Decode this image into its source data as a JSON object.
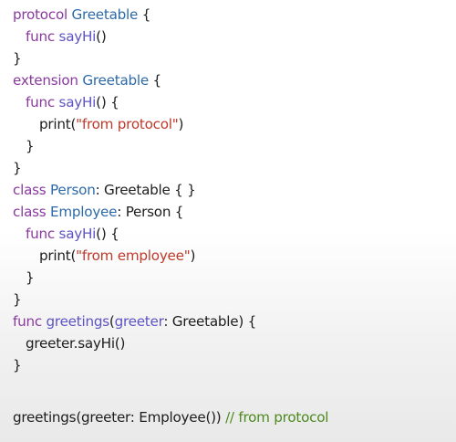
{
  "code_lines": [
    {
      "indent": 0,
      "tokens": [
        {
          "text": "protocol",
          "kind": "keyword"
        },
        {
          "text": " ",
          "kind": "plain"
        },
        {
          "text": "Greetable",
          "kind": "type"
        },
        {
          "text": " {",
          "kind": "plain"
        }
      ]
    },
    {
      "indent": 1,
      "tokens": [
        {
          "text": "func",
          "kind": "keyword"
        },
        {
          "text": " ",
          "kind": "plain"
        },
        {
          "text": "sayHi",
          "kind": "function"
        },
        {
          "text": "()",
          "kind": "plain"
        }
      ]
    },
    {
      "indent": 0,
      "tokens": [
        {
          "text": "}",
          "kind": "plain"
        }
      ]
    },
    {
      "indent": 0,
      "tokens": [
        {
          "text": "extension",
          "kind": "keyword"
        },
        {
          "text": " ",
          "kind": "plain"
        },
        {
          "text": "Greetable",
          "kind": "type"
        },
        {
          "text": " {",
          "kind": "plain"
        }
      ]
    },
    {
      "indent": 1,
      "tokens": [
        {
          "text": "func",
          "kind": "keyword"
        },
        {
          "text": " ",
          "kind": "plain"
        },
        {
          "text": "sayHi",
          "kind": "function"
        },
        {
          "text": "() {",
          "kind": "plain"
        }
      ]
    },
    {
      "indent": 2,
      "tokens": [
        {
          "text": "print",
          "kind": "plain"
        },
        {
          "text": "(",
          "kind": "plain"
        },
        {
          "text": "\"from protocol\"",
          "kind": "string"
        },
        {
          "text": ")",
          "kind": "plain"
        }
      ]
    },
    {
      "indent": 1,
      "tokens": [
        {
          "text": "}",
          "kind": "plain"
        }
      ]
    },
    {
      "indent": 0,
      "tokens": [
        {
          "text": "}",
          "kind": "plain"
        }
      ]
    },
    {
      "indent": 0,
      "tokens": [
        {
          "text": "class",
          "kind": "keyword"
        },
        {
          "text": " ",
          "kind": "plain"
        },
        {
          "text": "Person",
          "kind": "type"
        },
        {
          "text": ": Greetable { }",
          "kind": "plain"
        }
      ]
    },
    {
      "indent": 0,
      "tokens": [
        {
          "text": "class",
          "kind": "keyword"
        },
        {
          "text": " ",
          "kind": "plain"
        },
        {
          "text": "Employee",
          "kind": "type"
        },
        {
          "text": ": Person {",
          "kind": "plain"
        }
      ]
    },
    {
      "indent": 1,
      "tokens": [
        {
          "text": "func",
          "kind": "keyword"
        },
        {
          "text": " ",
          "kind": "plain"
        },
        {
          "text": "sayHi",
          "kind": "function"
        },
        {
          "text": "() {",
          "kind": "plain"
        }
      ]
    },
    {
      "indent": 2,
      "tokens": [
        {
          "text": "print",
          "kind": "plain"
        },
        {
          "text": "(",
          "kind": "plain"
        },
        {
          "text": "\"from employee\"",
          "kind": "string"
        },
        {
          "text": ")",
          "kind": "plain"
        }
      ]
    },
    {
      "indent": 1,
      "tokens": [
        {
          "text": "}",
          "kind": "plain"
        }
      ]
    },
    {
      "indent": 0,
      "tokens": [
        {
          "text": "}",
          "kind": "plain"
        }
      ]
    },
    {
      "indent": 0,
      "tokens": [
        {
          "text": "func",
          "kind": "keyword"
        },
        {
          "text": " ",
          "kind": "plain"
        },
        {
          "text": "greetings",
          "kind": "function"
        },
        {
          "text": "(",
          "kind": "plain"
        },
        {
          "text": "greeter",
          "kind": "function"
        },
        {
          "text": ": Greetable) {",
          "kind": "plain"
        }
      ]
    },
    {
      "indent": 1,
      "tokens": [
        {
          "text": "greeter.sayHi()",
          "kind": "plain"
        }
      ]
    },
    {
      "indent": 0,
      "tokens": [
        {
          "text": "}",
          "kind": "plain"
        }
      ]
    },
    {
      "indent": 0,
      "blank": true,
      "tokens": []
    },
    {
      "indent": 0,
      "tokens": [
        {
          "text": "greetings(greeter: Employee())",
          "kind": "plain"
        },
        {
          "text": " ",
          "kind": "plain"
        },
        {
          "text": "// from protocol",
          "kind": "comment"
        }
      ]
    }
  ],
  "colors": {
    "keyword": "#8a3a9e",
    "type": "#2d6aa8",
    "function": "#5d53c4",
    "string": "#c0392b",
    "comment": "#4c8a1e",
    "plain": "#1d1d1d"
  }
}
